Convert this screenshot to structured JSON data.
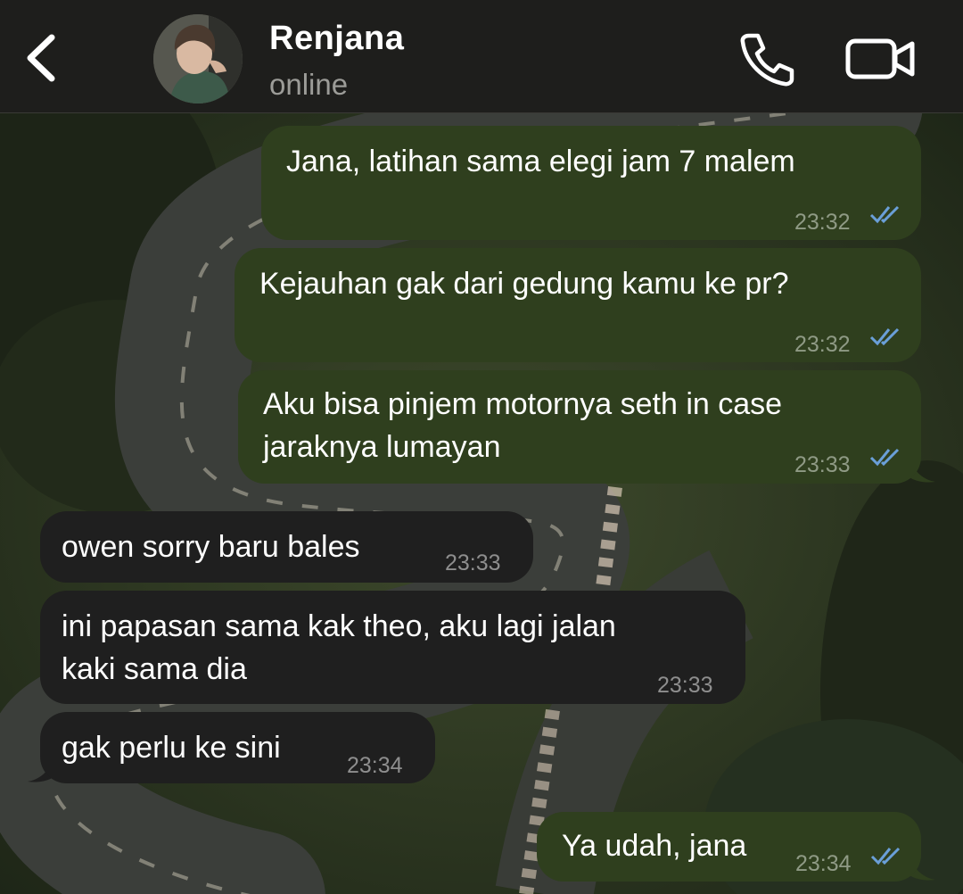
{
  "header": {
    "back_icon": "chevron-left-icon",
    "contact_name": "Renjana",
    "status": "online",
    "call_icon": "phone-icon",
    "video_icon": "video-camera-icon"
  },
  "colors": {
    "outgoing_bubble": "#2f3f1e",
    "incoming_bubble": "#1f1f1f",
    "read_ticks": "#6a9fd8",
    "header_bg": "#1e1e1c"
  },
  "messages": [
    {
      "direction": "outgoing",
      "lines": [
        "Jana, latihan sama elegi jam 7 malem"
      ],
      "time": "23:32",
      "status": "read"
    },
    {
      "direction": "outgoing",
      "lines": [
        "Kejauhan gak dari gedung kamu ke pr?"
      ],
      "time": "23:32",
      "status": "read"
    },
    {
      "direction": "outgoing",
      "lines": [
        "Aku bisa pinjem motornya seth in case",
        "jaraknya lumayan"
      ],
      "time": "23:33",
      "status": "read"
    },
    {
      "direction": "incoming",
      "lines": [
        "owen sorry baru bales"
      ],
      "time": "23:33"
    },
    {
      "direction": "incoming",
      "lines": [
        "ini papasan sama kak theo, aku lagi jalan",
        "kaki sama dia"
      ],
      "time": "23:33"
    },
    {
      "direction": "incoming",
      "lines": [
        "gak perlu ke sini"
      ],
      "time": "23:34"
    },
    {
      "direction": "outgoing",
      "lines": [
        "Ya udah, jana"
      ],
      "time": "23:34",
      "status": "read"
    }
  ]
}
